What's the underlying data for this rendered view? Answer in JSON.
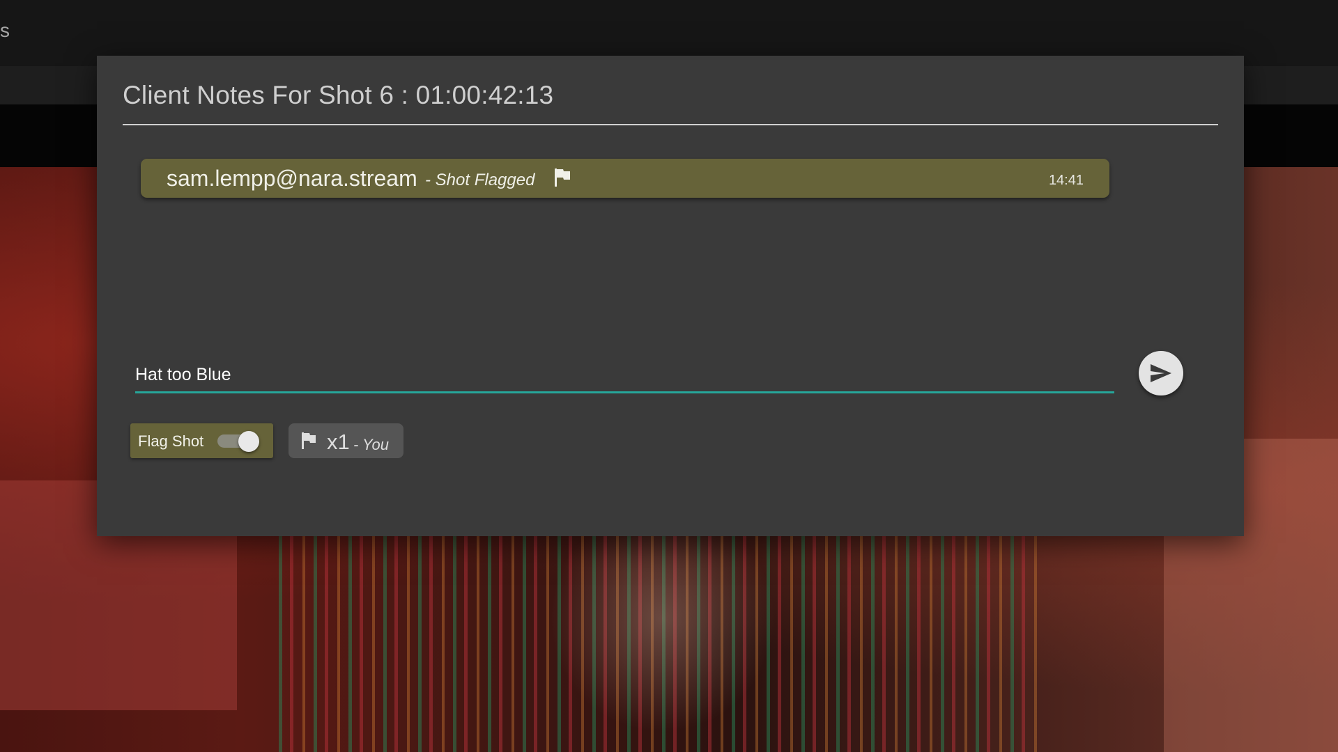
{
  "background_app": {
    "topbar_fragment": "s"
  },
  "modal": {
    "title": "Client Notes For Shot 6 : 01:00:42:13",
    "notes": [
      {
        "author": "sam.lempp@nara.stream",
        "action": "- Shot Flagged",
        "icon": "flag-icon",
        "time": "14:41"
      }
    ],
    "input": {
      "value": "Hat too Blue",
      "underline_color": "#26a69a"
    },
    "send_button": {
      "icon": "send-icon"
    },
    "flag_shot": {
      "label": "Flag Shot",
      "toggle_state": "on"
    },
    "flag_count": {
      "icon": "flag-icon",
      "count": "x1",
      "who": "- You"
    }
  },
  "colors": {
    "modal_background": "#3a3a3a",
    "note_highlight": "#666339",
    "accent": "#26a69a"
  }
}
